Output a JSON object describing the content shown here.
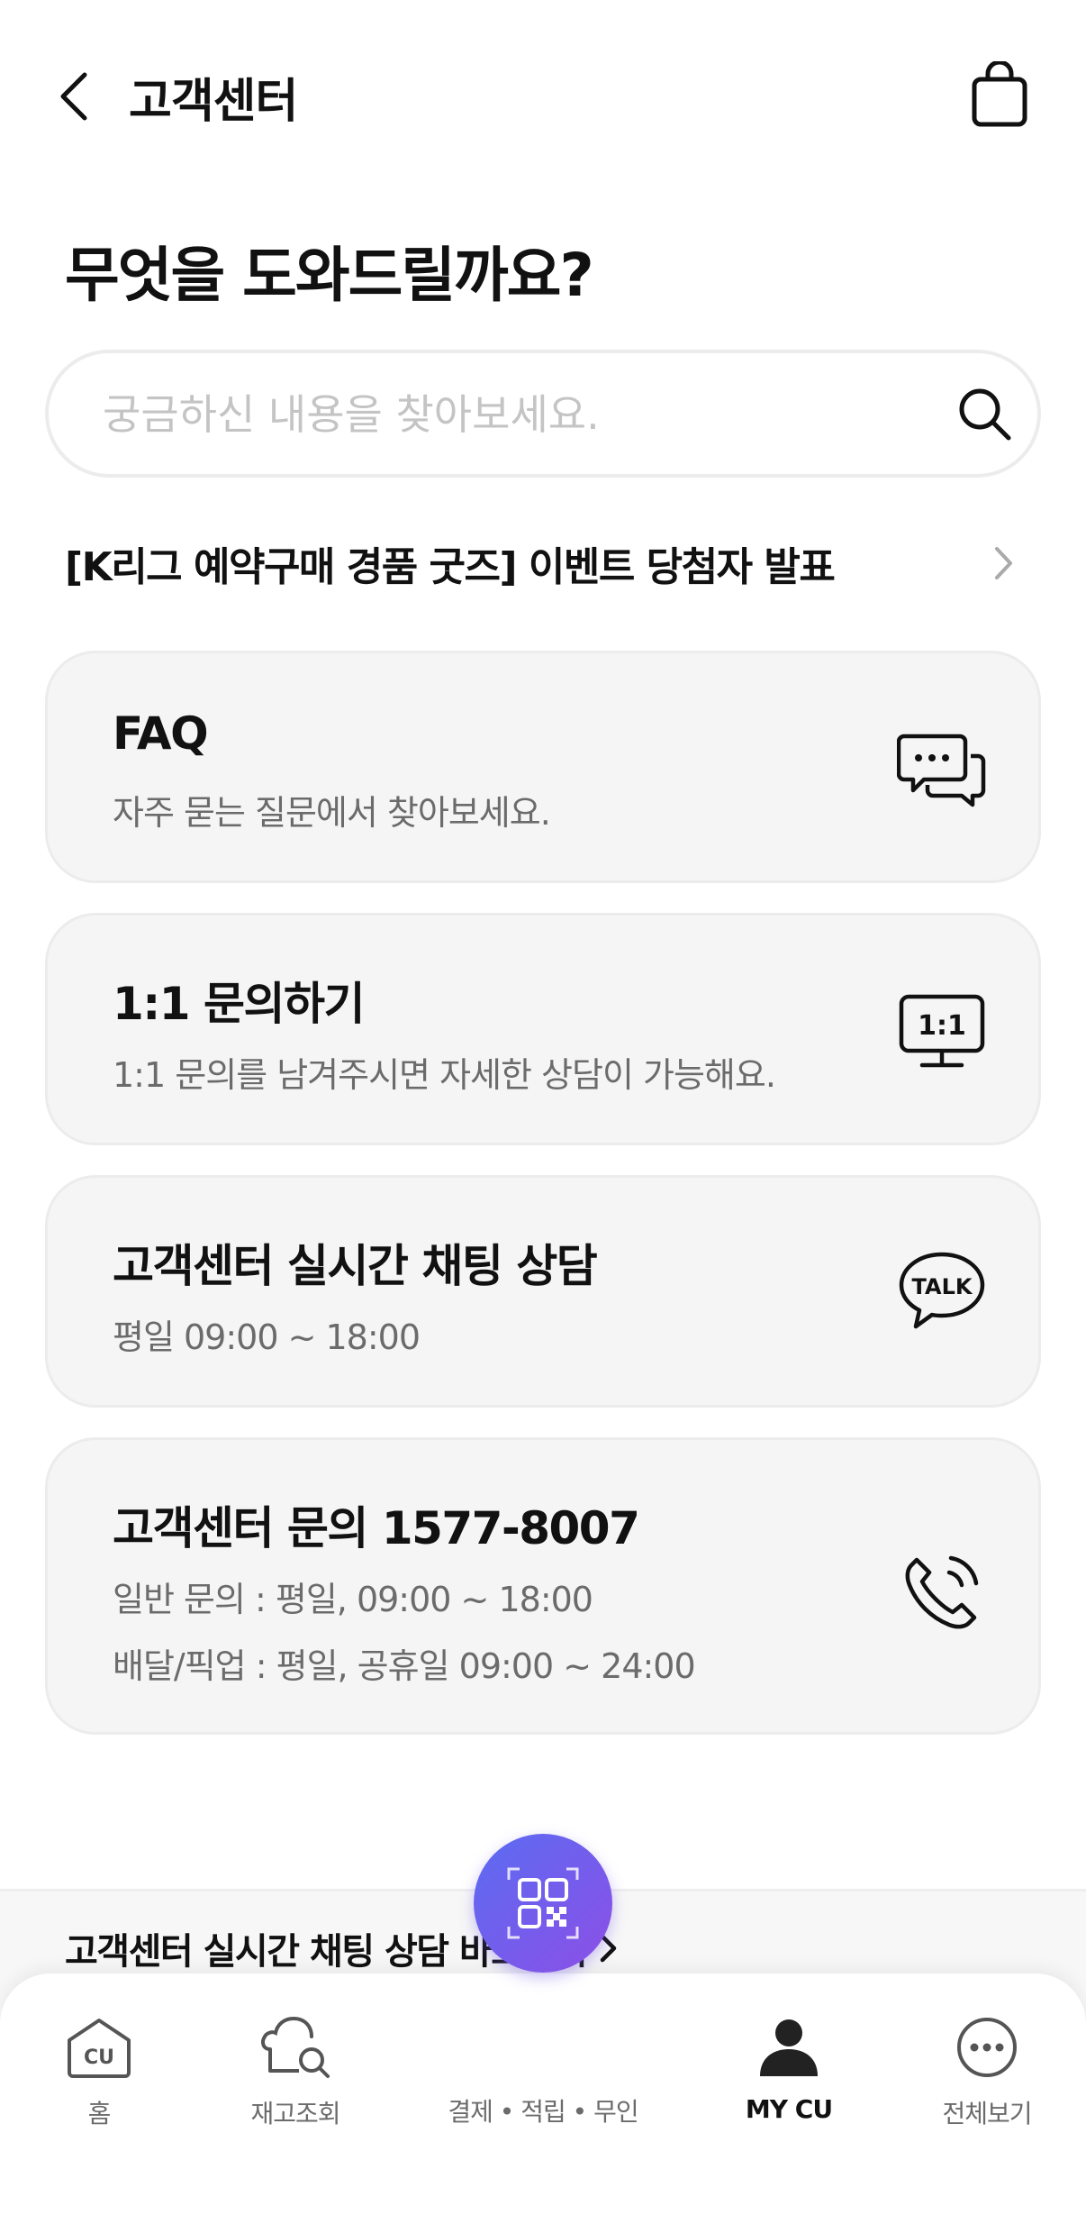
{
  "header": {
    "title": "고객센터",
    "back_icon": "chevron-left-icon",
    "cart_icon": "shopping-bag-icon"
  },
  "main": {
    "heading": "무엇을 도와드릴까요?",
    "search": {
      "placeholder": "궁금하신 내용을 찾아보세요.",
      "value": "",
      "icon": "search-icon"
    },
    "notice": {
      "text": "[K리그 예약구매 경품 굿즈] 이벤트 당첨자 발표",
      "icon": "chevron-right-icon"
    },
    "cards": [
      {
        "title": "FAQ",
        "lines": [
          "자주 묻는 질문에서 찾아보세요."
        ],
        "icon": "chat-bubbles-icon"
      },
      {
        "title": "1:1 문의하기",
        "lines": [
          "1:1 문의를 남겨주시면 자세한 상담이 가능해요."
        ],
        "icon": "one-on-one-icon",
        "icon_text": "1:1"
      },
      {
        "title": "고객센터 실시간 채팅 상담",
        "lines": [
          "평일 09:00 ~ 18:00"
        ],
        "icon": "talk-bubble-icon",
        "icon_text": "TALK"
      },
      {
        "title": "고객센터 문의 1577-8007",
        "lines": [
          "일반 문의 : 평일, 09:00 ~ 18:00",
          "배달/픽업 : 평일, 공휴일 09:00 ~ 24:00"
        ],
        "icon": "phone-call-icon"
      }
    ],
    "chat_link": "고객센터 실시간 채팅 상담 바로가기"
  },
  "tabbar": {
    "items": [
      {
        "label": "홈",
        "icon": "cu-home-icon",
        "icon_text": "CU",
        "active": false
      },
      {
        "label": "재고조회",
        "icon": "stock-search-icon",
        "active": false
      },
      {
        "label": "결제 • 적립 • 무인",
        "icon": "qr-code-icon",
        "active": false
      },
      {
        "label": "MY CU",
        "icon": "user-icon",
        "active": true
      },
      {
        "label": "전체보기",
        "icon": "more-icon",
        "active": false
      }
    ]
  },
  "colors": {
    "card_background": "#f5f5f5",
    "text_primary": "#111111",
    "text_secondary": "#6b6b6b",
    "placeholder": "#c4c4c4",
    "fab_gradient_start": "#5b6cf2",
    "fab_gradient_end": "#8c4fe6"
  }
}
